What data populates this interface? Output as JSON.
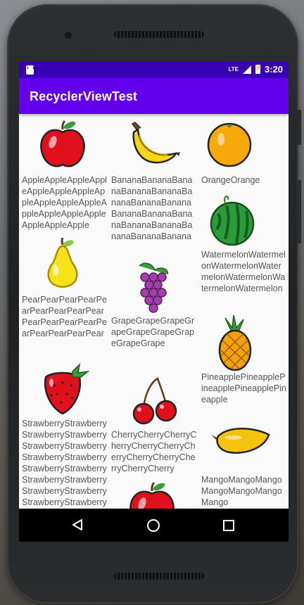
{
  "status_bar": {
    "network": "LTE",
    "time": "3:20"
  },
  "app_bar": {
    "title": "RecyclerViewTest"
  },
  "colors": {
    "status_bar": "#3700b3",
    "app_bar": "#6200ee",
    "nav_bar": "#000000"
  },
  "fruits": [
    {
      "name": "AppleAppleAppleAppleAppleAppleAppleAppleAppleAppleAppleAppleAppleAppleAppleAppleAppleApple",
      "icon": "apple-icon"
    },
    {
      "name": "BananaBananaBananaBananaBananaBananaBananaBananaBananaBananaBananaBananaBananaBananaBananaBanana",
      "icon": "banana-icon"
    },
    {
      "name": "OrangeOrange",
      "icon": "orange-icon"
    },
    {
      "name": "WatermelonWatermelonWatermelonWatermelonWatermelonWatermelonWatermelon",
      "icon": "watermelon-icon"
    },
    {
      "name": "PearPearPearPearPearPearPearPearPearPearPearPearPearPearPearPearPearPear",
      "icon": "pear-icon"
    },
    {
      "name": "GrapeGrapeGrapeGrapeGrapeGrapeGrapeGrapeGrape",
      "icon": "grape-icon"
    },
    {
      "name": "PineapplePineapplePineapplePineapplePineapple",
      "icon": "pineapple-icon"
    },
    {
      "name": "StrawberryStrawberryStrawberryStrawberryStrawberryStrawberryStrawberryStrawberryStrawberryStrawberryStrawberryStrawberryStrawberryStrawberryStrawberryStrawberry",
      "icon": "strawberry-icon"
    },
    {
      "name": "CherryCherryCherryCherryCherryCherryCherryCherryCherryCherryCherryCherry",
      "icon": "cherry-icon"
    },
    {
      "name": "MangoMangoMangoMangoMangoMangoMango",
      "icon": "mango-icon"
    },
    {
      "name": "",
      "icon": "apple-icon"
    }
  ]
}
